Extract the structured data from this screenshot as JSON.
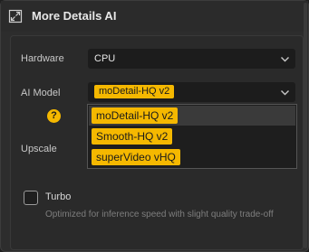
{
  "header": {
    "title": "More Details AI",
    "icon": "expand-icon"
  },
  "hardware": {
    "label": "Hardware",
    "value": "CPU"
  },
  "ai_model": {
    "label": "AI Model",
    "value": "moDetail-HQ  v2",
    "options": [
      "moDetail-HQ  v2",
      "Smooth-HQ  v2",
      "superVideo vHQ"
    ],
    "selected_index": 0
  },
  "upscale": {
    "label": "Upscale"
  },
  "help": {
    "glyph": "?"
  },
  "turbo": {
    "label": "Turbo",
    "checked": false,
    "description": "Optimized for inference speed with slight quality trade-off"
  },
  "colors": {
    "accent": "#f5b800",
    "panel": "#2d2d2d",
    "field": "#1c1c1c"
  }
}
